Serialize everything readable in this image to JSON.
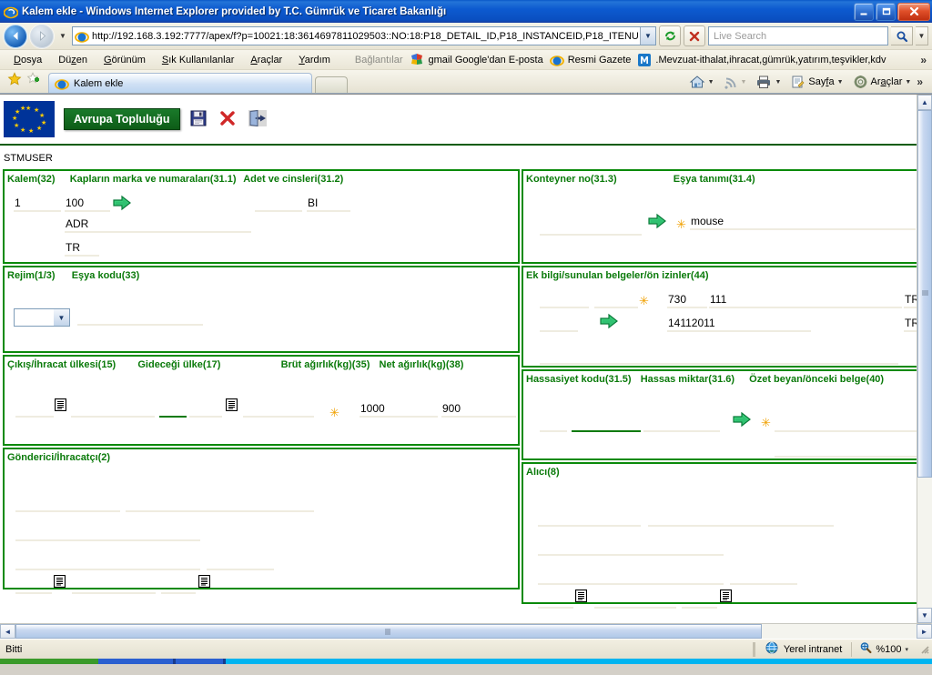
{
  "window": {
    "title": "Kalem ekle - Windows Internet Explorer provided by T.C. Gümrük ve Ticaret Bakanlığı",
    "minimize_label": "_",
    "restore_label": "❐",
    "close_label": "✕"
  },
  "address": {
    "url": "http://192.168.3.192:7777/apex/f?p=10021:18:3614697811029503::NO:18:P18_DETAIL_ID,P18_INSTANCEID,P18_ITENU",
    "refresh_icon": "refresh-icon",
    "stop_icon": "stop-icon",
    "back_icon": "back-arrow-icon",
    "forward_icon": "forward-arrow-icon"
  },
  "search": {
    "placeholder": "Live Search",
    "value": "",
    "go_icon": "magnifier-icon"
  },
  "menu": {
    "items": [
      {
        "label": "Dosya",
        "accel": "D"
      },
      {
        "label": "Düzen",
        "accel": "z"
      },
      {
        "label": "Görünüm",
        "accel": "G"
      },
      {
        "label": "Sık Kullanılanlar",
        "accel": "S"
      },
      {
        "label": "Araçlar",
        "accel": "A"
      },
      {
        "label": "Yardım",
        "accel": "Y"
      }
    ],
    "links_label": "Bağlantılar",
    "links": [
      {
        "label": "gmail Google'dan E-posta",
        "icon": "google-icon"
      },
      {
        "label": "Resmi Gazete",
        "icon": "ie-icon"
      },
      {
        "label": ".Mevzuat-ithalat,ihracat,gümrük,yatırım,teşvikler,kdv",
        "icon": "mevzuat-m-icon"
      }
    ],
    "overflow": "»"
  },
  "tabs": {
    "favorites_icon": "favorites-star-icon",
    "add_favorite_icon": "add-favorite-icon",
    "items": [
      {
        "label": "Kalem ekle",
        "icon": "ie-icon",
        "active": true
      }
    ],
    "toolbar_right": [
      {
        "label": "",
        "icon": "home-icon",
        "has_caret": true
      },
      {
        "label": "",
        "icon": "rss-icon",
        "has_caret": true
      },
      {
        "label": "",
        "icon": "printer-icon",
        "has_caret": true
      },
      {
        "label": "Sayfa",
        "icon": "page-icon",
        "has_caret": true,
        "accel": "f"
      },
      {
        "label": "Araçlar",
        "icon": "gear-icon",
        "has_caret": true,
        "accel": "a"
      }
    ],
    "overflow": "»"
  },
  "app": {
    "brand_label": "Avrupa Topluluğu",
    "flag_icon": "eu-flag-icon",
    "save_icon": "save-floppy-icon",
    "delete_icon": "delete-x-icon",
    "exit_icon": "exit-door-icon",
    "user": "STMUSER"
  },
  "form": {
    "panels": [
      {
        "id": "kalem",
        "titles": [
          "Kalem(32)",
          "Kapların marka ve numaraları(31.1)",
          "Adet ve cinsleri(31.2)"
        ],
        "fields": [
          {
            "name": "kalem-no",
            "value": "1"
          },
          {
            "name": "kap-marka-adet",
            "value": "100"
          },
          {
            "name": "adet-cinsleri-blank",
            "value": ""
          },
          {
            "name": "kap-cinsi-code",
            "value": "BI"
          },
          {
            "name": "kap-marka-text",
            "value": "ADR"
          },
          {
            "name": "kap-ulke",
            "value": "TR"
          }
        ],
        "icons": [
          "lov-arrow-icon"
        ]
      },
      {
        "id": "rejim",
        "titles": [
          "Rejim(1/3)",
          "Eşya kodu(33)"
        ],
        "fields": [
          {
            "name": "rejim-select",
            "value": ""
          },
          {
            "name": "esya-kodu",
            "value": ""
          }
        ]
      },
      {
        "id": "ulke-agirlik",
        "titles": [
          "Çıkış/İhracat ülkesi(15)",
          "Gideceği ülke(17)",
          "Brüt ağırlık(kg)(35)",
          "Net ağırlık(kg)(38)"
        ],
        "fields": [
          {
            "name": "cikis-ulke-code",
            "value": ""
          },
          {
            "name": "cikis-ulke-name",
            "value": ""
          },
          {
            "name": "gidecegi-ulke-code",
            "value": ""
          },
          {
            "name": "gidecegi-ulke-name",
            "value": ""
          },
          {
            "name": "brut-agirlik",
            "value": "1000"
          },
          {
            "name": "net-agirlik",
            "value": "900"
          }
        ]
      },
      {
        "id": "gonderici",
        "titles": [
          "Gönderici/İhracatçı(2)"
        ],
        "fields": []
      },
      {
        "id": "konteyner",
        "titles": [
          "Konteyner no(31.3)",
          "Eşya tanımı(31.4)"
        ],
        "fields": [
          {
            "name": "konteyner-no",
            "value": ""
          },
          {
            "name": "esya-tanimi",
            "value": "mouse"
          }
        ]
      },
      {
        "id": "ek-bilgi",
        "titles": [
          "Ek bilgi/sunulan belgeler/ön izinler(44)"
        ],
        "fields": [
          {
            "name": "belge-kodu-1",
            "value": "730"
          },
          {
            "name": "belge-no-1",
            "value": "111"
          },
          {
            "name": "belge-ulke-1",
            "value": "TR"
          },
          {
            "name": "belge-tarih-2",
            "value": "14112011"
          },
          {
            "name": "belge-ulke-2",
            "value": "TR"
          }
        ]
      },
      {
        "id": "hassasiyet",
        "titles": [
          "Hassasiyet kodu(31.5)",
          "Hassas miktar(31.6)",
          "Özet beyan/önceki belge(40)"
        ],
        "fields": []
      },
      {
        "id": "alici",
        "titles": [
          "Alıcı(8)"
        ],
        "fields": []
      }
    ]
  },
  "status": {
    "text": "Bitti",
    "zone_label": "Yerel intranet",
    "zone_icon": "globe-icon",
    "zoom_label": "%100",
    "zoom_icon": "zoom-magnifier-icon",
    "zoom_caret": "▾"
  },
  "colors": {
    "panel_border": "#0a8a0a",
    "panel_title": "#0a7a0a",
    "field_underline": "#efece0",
    "brand_green": "#0d5c17",
    "required_star": "#f0a000",
    "title_blue": "#0d5ad0"
  }
}
